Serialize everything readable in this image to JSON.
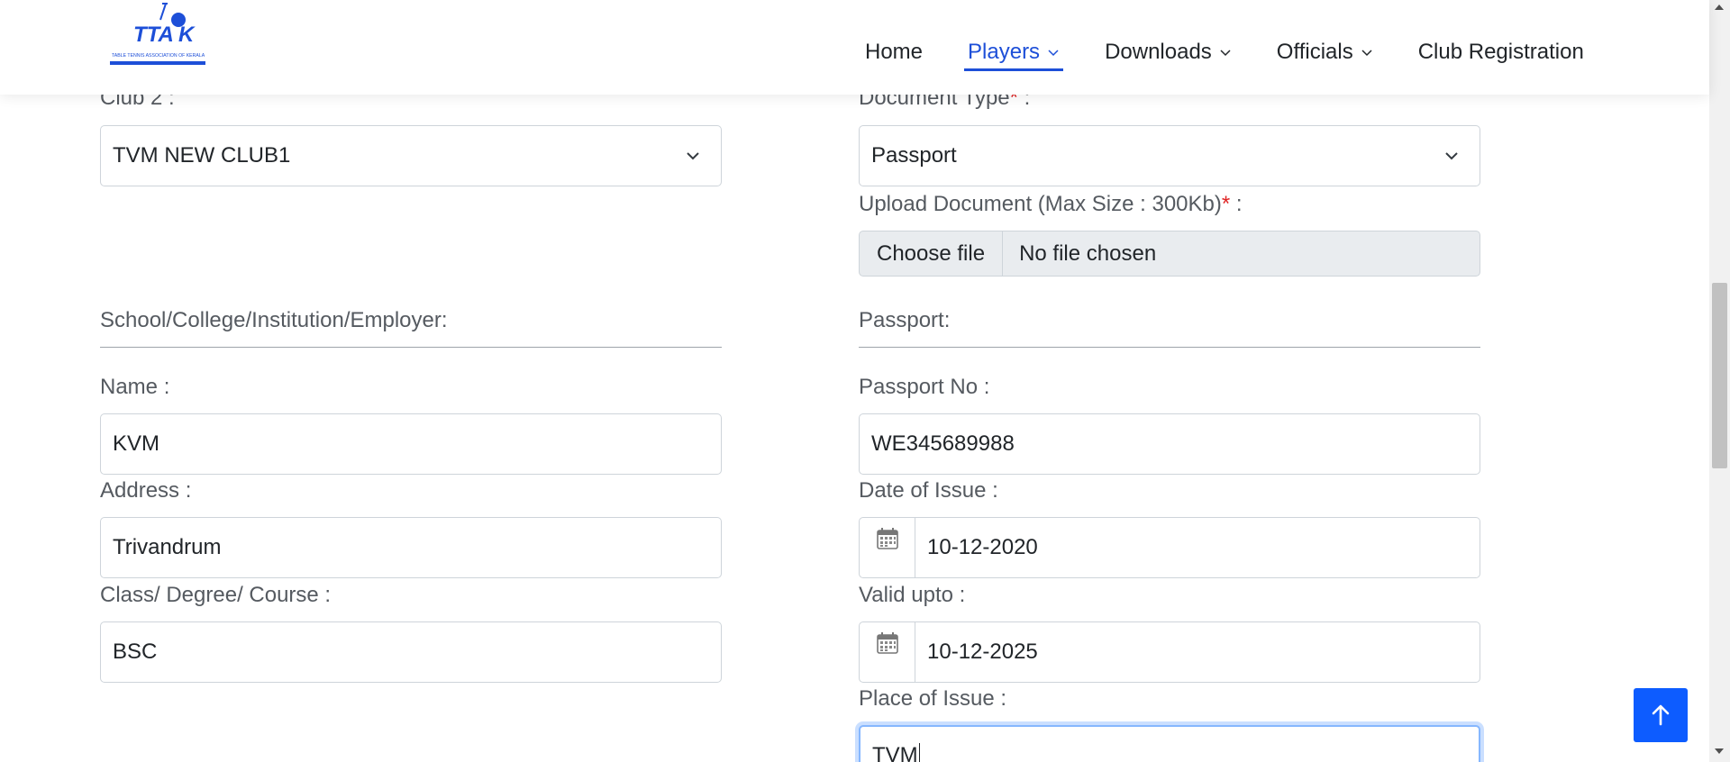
{
  "brand": {
    "logo_text": "TTAK",
    "logo_subtitle": "TABLE TENNIS ASSOCIATION OF KERALA",
    "accent": "#1d4fd8"
  },
  "nav": {
    "items": [
      {
        "label": "Home"
      },
      {
        "label": "Players"
      },
      {
        "label": "Downloads"
      },
      {
        "label": "Officials"
      },
      {
        "label": "Club Registration"
      }
    ]
  },
  "left": {
    "club2": {
      "label": "Club 2 :",
      "value": "TVM NEW CLUB1"
    },
    "school_section": "School/College/Institution/Employer:",
    "name": {
      "label": "Name :",
      "value": "KVM"
    },
    "address": {
      "label": "Address :",
      "value": "Trivandrum"
    },
    "course": {
      "label": "Class/ Degree/ Course :",
      "value": "BSC"
    }
  },
  "right": {
    "doc_type": {
      "label": "Document Type",
      "suffix": " :",
      "value": "Passport"
    },
    "upload": {
      "label": "Upload Document (Max Size : 300Kb)",
      "suffix": " :",
      "button": "Choose file",
      "status": "No file chosen"
    },
    "passport_section": "Passport:",
    "passport_no": {
      "label": "Passport No :",
      "value": "WE345689988"
    },
    "date_issue": {
      "label": "Date of Issue :",
      "value": "10-12-2020"
    },
    "valid_upto": {
      "label": "Valid upto :",
      "value": "10-12-2025"
    },
    "place_issue": {
      "label": "Place of Issue :",
      "value": "TVM"
    }
  },
  "required_mark": "*"
}
